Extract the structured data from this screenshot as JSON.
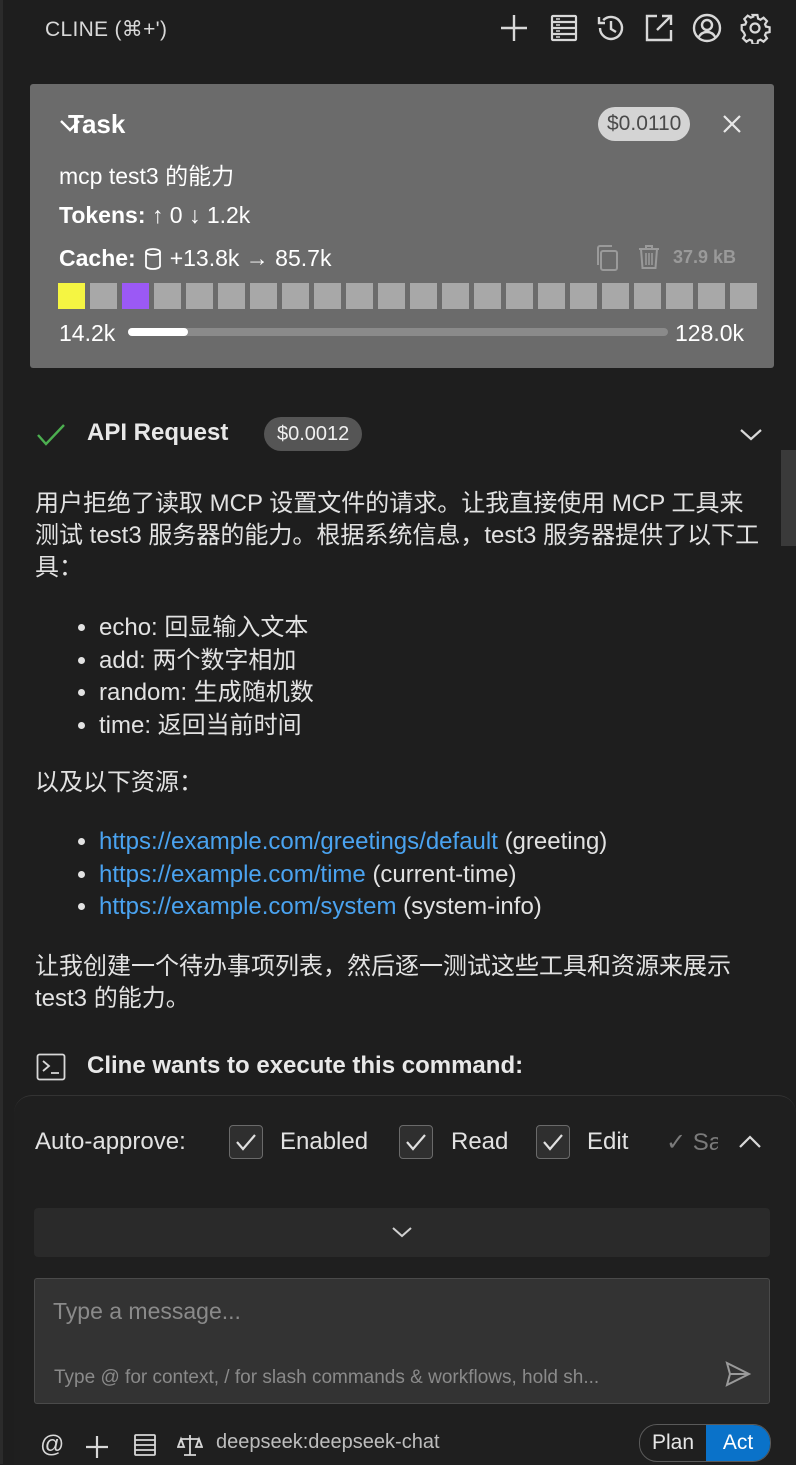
{
  "header": {
    "title": "CLINE (⌘+')"
  },
  "task": {
    "title": "Task",
    "cost": "$0.0110",
    "text": "mcp test3 的能力",
    "tokens_label": "Tokens:",
    "tokens_value": "↑ 0 ↓ 1.2k",
    "cache_label": "Cache:",
    "cache_value": "+13.8k → 85.7k",
    "size": "37.9 kB",
    "context_used": "14.2k",
    "context_max": "128.0k",
    "context_fraction": 0.111,
    "blocks": [
      "#f5f542",
      "#a8a8a8",
      "#9b59f5",
      "#a8a8a8",
      "#a8a8a8",
      "#a8a8a8",
      "#a8a8a8",
      "#a8a8a8",
      "#a8a8a8",
      "#a8a8a8",
      "#a8a8a8",
      "#a8a8a8",
      "#a8a8a8",
      "#a8a8a8",
      "#a8a8a8",
      "#a8a8a8",
      "#a8a8a8",
      "#a8a8a8",
      "#a8a8a8",
      "#a8a8a8",
      "#a8a8a8",
      "#a8a8a8"
    ]
  },
  "api_request": {
    "title": "API Request",
    "cost": "$0.0012"
  },
  "message": {
    "intro": "用户拒绝了读取 MCP 设置文件的请求。让我直接使用 MCP 工具来测试 test3 服务器的能力。根据系统信息，test3 服务器提供了以下工具：",
    "tools": [
      "echo: 回显输入文本",
      "add: 两个数字相加",
      "random: 生成随机数",
      "time: 返回当前时间"
    ],
    "resources_label": "以及以下资源：",
    "resources": [
      {
        "url": "https://example.com/greetings/default",
        "desc": "(greeting)"
      },
      {
        "url": "https://example.com/time",
        "desc": "(current-time)"
      },
      {
        "url": "https://example.com/system",
        "desc": "(system-info)"
      }
    ],
    "outro": "让我创建一个待办事项列表，然后逐一测试这些工具和资源来展示 test3 的能力。"
  },
  "command": {
    "title": "Cline wants to execute this command:"
  },
  "auto_approve": {
    "label": "Auto-approve:",
    "items": [
      "Enabled",
      "Read",
      "Edit"
    ],
    "faded": "✓ Sa"
  },
  "input": {
    "placeholder": "Type a message...",
    "hint": "Type @ for context, / for slash commands & workflows, hold sh..."
  },
  "footer": {
    "at": "@",
    "model": "deepseek:deepseek-chat",
    "mode_plan": "Plan",
    "mode_act": "Act"
  },
  "colors": {
    "accent": "#0a72c9",
    "link": "#4aa3f0",
    "check": "#4caf50"
  }
}
